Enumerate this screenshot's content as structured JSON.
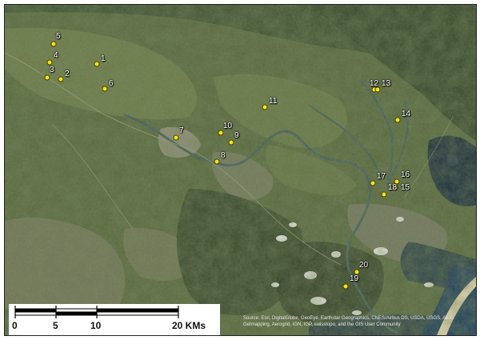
{
  "map": {
    "sites": [
      {
        "id": "1",
        "pos": [
          115,
          74
        ],
        "label_off": [
          5,
          -11
        ]
      },
      {
        "id": "2",
        "pos": [
          70,
          93
        ],
        "label_off": [
          5,
          -11
        ]
      },
      {
        "id": "3",
        "pos": [
          53,
          91
        ],
        "label_off": [
          3,
          -14
        ]
      },
      {
        "id": "4",
        "pos": [
          56,
          72
        ],
        "label_off": [
          5,
          -13
        ]
      },
      {
        "id": "5",
        "pos": [
          61,
          49
        ],
        "label_off": [
          3,
          -14
        ]
      },
      {
        "id": "6",
        "pos": [
          125,
          105
        ],
        "label_off": [
          5,
          -11
        ]
      },
      {
        "id": "7",
        "pos": [
          214,
          166
        ],
        "label_off": [
          4,
          -13
        ]
      },
      {
        "id": "8",
        "pos": [
          265,
          196
        ],
        "label_off": [
          5,
          -12
        ]
      },
      {
        "id": "9",
        "pos": [
          283,
          172
        ],
        "label_off": [
          4,
          -13
        ]
      },
      {
        "id": "10",
        "pos": [
          270,
          160
        ],
        "label_off": [
          3,
          -13
        ]
      },
      {
        "id": "11",
        "pos": [
          325,
          128
        ],
        "label_off": [
          5,
          -12
        ]
      },
      {
        "id": "12",
        "pos": [
          462,
          106
        ],
        "label_off": [
          -6,
          -12
        ]
      },
      {
        "id": "13",
        "pos": [
          466,
          106
        ],
        "label_off": [
          5,
          -12
        ]
      },
      {
        "id": "14",
        "pos": [
          491,
          144
        ],
        "label_off": [
          5,
          -12
        ]
      },
      {
        "id": "15",
        "pos": [
          488,
          228
        ],
        "label_off": [
          7,
          -4
        ]
      },
      {
        "id": "16",
        "pos": [
          490,
          221
        ],
        "label_off": [
          5,
          -13
        ]
      },
      {
        "id": "17",
        "pos": [
          460,
          223
        ],
        "label_off": [
          5,
          -13
        ]
      },
      {
        "id": "18",
        "pos": [
          474,
          237
        ],
        "label_off": [
          5,
          -13
        ]
      },
      {
        "id": "19",
        "pos": [
          426,
          352
        ],
        "label_off": [
          5,
          -14
        ]
      },
      {
        "id": "20",
        "pos": [
          440,
          334
        ],
        "label_off": [
          3,
          -13
        ]
      }
    ]
  },
  "scale_bar": {
    "labels": [
      "0",
      "5",
      "10",
      "20 KMs"
    ],
    "unit": "KMs"
  },
  "credits": "Source: Esri, DigitalGlobe, GeoEye, Earthstar Geographics, CNES/Airbus DS, USDA, USGS, AEX, Getmapping, Aerogrid, IGN, IGP, swisstopo, and the GIS User Community"
}
